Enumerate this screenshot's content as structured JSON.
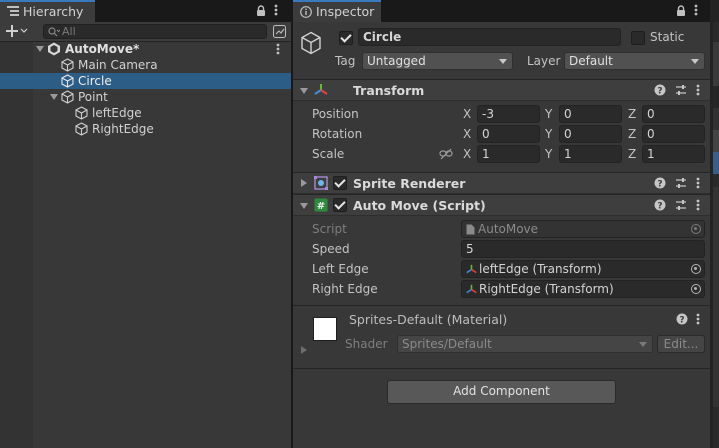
{
  "hierarchy": {
    "tab_label": "Hierarchy",
    "search_placeholder": "All",
    "scene_name": "AutoMove*",
    "items": [
      {
        "label": "Main Camera"
      },
      {
        "label": "Circle"
      },
      {
        "label": "Point"
      },
      {
        "label": "leftEdge"
      },
      {
        "label": "RightEdge"
      }
    ]
  },
  "inspector": {
    "tab_label": "Inspector",
    "object_name": "Circle",
    "static_label": "Static",
    "tag_label": "Tag",
    "tag_value": "Untagged",
    "layer_label": "Layer",
    "layer_value": "Default",
    "transform": {
      "title": "Transform",
      "position_label": "Position",
      "rotation_label": "Rotation",
      "scale_label": "Scale",
      "axes": [
        "X",
        "Y",
        "Z"
      ],
      "position": [
        "-3",
        "0",
        "0"
      ],
      "rotation": [
        "0",
        "0",
        "0"
      ],
      "scale": [
        "1",
        "1",
        "1"
      ]
    },
    "sprite_renderer": {
      "title": "Sprite Renderer"
    },
    "auto_move": {
      "title": "Auto Move (Script)",
      "script_label": "Script",
      "script_value": "AutoMove",
      "speed_label": "Speed",
      "speed_value": "5",
      "left_edge_label": "Left Edge",
      "left_edge_value": "leftEdge (Transform)",
      "right_edge_label": "Right Edge",
      "right_edge_value": "RightEdge (Transform)"
    },
    "material": {
      "title": "Sprites-Default (Material)",
      "shader_label": "Shader",
      "shader_value": "Sprites/Default",
      "edit_label": "Edit..."
    },
    "add_component_label": "Add Component"
  },
  "colors": {
    "selection": "#2c5d87",
    "accent": "#3a79bb",
    "panel": "#383838"
  }
}
